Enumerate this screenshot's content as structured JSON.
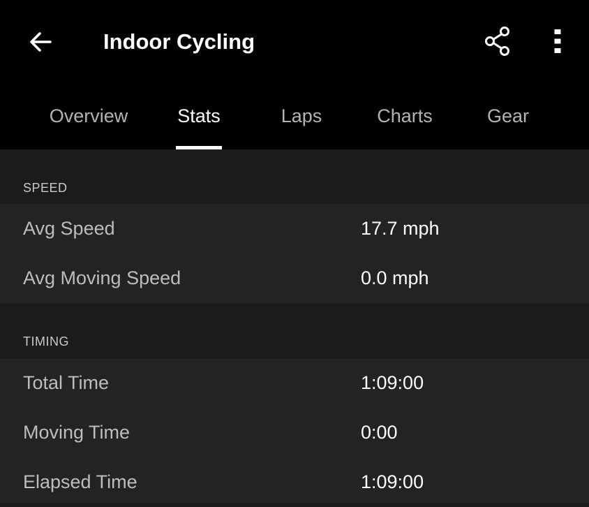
{
  "header": {
    "title": "Indoor Cycling",
    "back_icon": "arrow-left-icon",
    "share_icon": "share-icon",
    "more_icon": "more-vert-icon"
  },
  "tabs": [
    {
      "label": "Overview",
      "active": false
    },
    {
      "label": "Stats",
      "active": true
    },
    {
      "label": "Laps",
      "active": false
    },
    {
      "label": "Charts",
      "active": false
    },
    {
      "label": "Gear",
      "active": false
    }
  ],
  "sections": {
    "speed": {
      "title": "SPEED",
      "rows": [
        {
          "label": "Avg Speed",
          "value": "17.7 mph"
        },
        {
          "label": "Avg Moving Speed",
          "value": "0.0 mph"
        }
      ]
    },
    "timing": {
      "title": "TIMING",
      "rows": [
        {
          "label": "Total Time",
          "value": "1:09:00"
        },
        {
          "label": "Moving Time",
          "value": "0:00"
        },
        {
          "label": "Elapsed Time",
          "value": "1:09:00"
        }
      ]
    }
  },
  "colors": {
    "appbar_bg": "#000000",
    "page_bg": "#1b1b1b",
    "row_bg": "#232323",
    "active_tab": "#ffffff",
    "inactive_tab": "#b3b3b3"
  }
}
